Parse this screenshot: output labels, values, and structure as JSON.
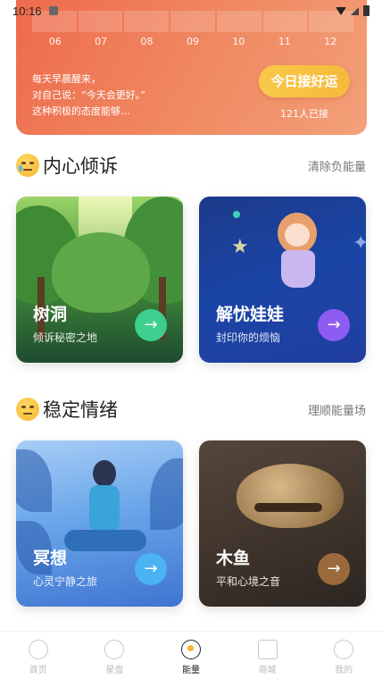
{
  "status_bar": {
    "time": "10:16"
  },
  "banner": {
    "week_days": [
      "06",
      "07",
      "08",
      "09",
      "10",
      "11",
      "12"
    ],
    "message_lines": [
      "每天早晨醒来，",
      "对自己说：“今天会更好。”",
      "这种积极的态度能够…"
    ],
    "cta_label": "今日接好运",
    "count_text": "121人已接"
  },
  "section_vent": {
    "title": "内心倾诉",
    "link": "清除负能量",
    "cards": [
      {
        "title": "树洞",
        "subtitle": "倾诉秘密之地"
      },
      {
        "title": "解忧娃娃",
        "subtitle": "封印你的烦恼"
      }
    ]
  },
  "section_calm": {
    "title": "稳定情绪",
    "link": "理顺能量场",
    "cards": [
      {
        "title": "冥想",
        "subtitle": "心灵宁静之旅"
      },
      {
        "title": "木鱼",
        "subtitle": "平和心境之音"
      }
    ]
  },
  "bottom_nav": [
    {
      "label": "首页"
    },
    {
      "label": "星盘"
    },
    {
      "label": "能量"
    },
    {
      "label": "商城"
    },
    {
      "label": "我的"
    }
  ],
  "colors": {
    "banner": "#ee6a4c",
    "cta": "#f6b93b",
    "forest_button": "#3ecf8e",
    "doll_button": "#8e5cf2",
    "meditate_button": "#4bb3f2",
    "fish_button": "#9a6a3c"
  },
  "icons": {
    "arrow": "→"
  }
}
